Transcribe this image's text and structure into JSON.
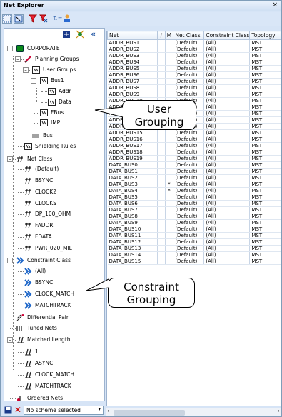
{
  "window": {
    "title": "Net Explorer",
    "close_glyph": "×"
  },
  "tree": [
    {
      "label": "CORPORATE",
      "icon": "corporate-icon"
    },
    {
      "label": "Planning Groups",
      "icon": "planning-icon"
    },
    {
      "label": "User Groups",
      "icon": "bus-icon"
    },
    {
      "label": "Bus1",
      "icon": "bus-icon"
    },
    {
      "label": "Addr",
      "icon": "bus-icon"
    },
    {
      "label": "Data",
      "icon": "bus-icon"
    },
    {
      "label": "FBus",
      "icon": "bus-icon"
    },
    {
      "label": "IMP",
      "icon": "bus-icon"
    },
    {
      "label": "Bus",
      "icon": "bus-lines-icon"
    },
    {
      "label": "Shielding Rules",
      "icon": "bus-icon"
    },
    {
      "label": "Net Class",
      "icon": "net-icon"
    },
    {
      "label": "(Default)",
      "icon": "net-icon"
    },
    {
      "label": "BSYNC",
      "icon": "net-icon"
    },
    {
      "label": "CLOCK2",
      "icon": "net-icon"
    },
    {
      "label": "CLOCKS",
      "icon": "net-icon"
    },
    {
      "label": "DP_100_OHM",
      "icon": "net-icon"
    },
    {
      "label": "FADDR",
      "icon": "net-icon"
    },
    {
      "label": "FDATA",
      "icon": "net-icon"
    },
    {
      "label": "PWR_020_MIL",
      "icon": "net-icon"
    },
    {
      "label": "Constraint Class",
      "icon": "constraint-class-icon"
    },
    {
      "label": "(All)",
      "icon": "constraint-class-icon"
    },
    {
      "label": "BSYNC",
      "icon": "constraint-class-icon"
    },
    {
      "label": "CLOCK_MATCH",
      "icon": "constraint-class-icon"
    },
    {
      "label": "MATCHTRACK",
      "icon": "constraint-class-icon"
    },
    {
      "label": "Differential Pair",
      "icon": "diff-pair-icon"
    },
    {
      "label": "Tuned Nets",
      "icon": "tuned-nets-icon"
    },
    {
      "label": "Matched Length",
      "icon": "matched-length-icon"
    },
    {
      "label": "1",
      "icon": "matched-length-icon"
    },
    {
      "label": "ASYNC",
      "icon": "matched-length-icon"
    },
    {
      "label": "CLOCK_MATCH",
      "icon": "matched-length-icon"
    },
    {
      "label": "MATCHTRACK",
      "icon": "matched-length-icon"
    },
    {
      "label": "Ordered Nets",
      "icon": "ordered-nets-icon"
    }
  ],
  "grid": {
    "headers": [
      "Net",
      "/",
      "M",
      "Net Class",
      "Constraint Class",
      "Topology"
    ],
    "rows": [
      [
        "ADDR_BUS1",
        "",
        "",
        "(Default)",
        "(All)",
        "MST"
      ],
      [
        "ADDR_BUS2",
        "",
        "",
        "(Default)",
        "(All)",
        "MST"
      ],
      [
        "ADDR_BUS3",
        "",
        "",
        "(Default)",
        "(All)",
        "MST"
      ],
      [
        "ADDR_BUS4",
        "",
        "",
        "(Default)",
        "(All)",
        "MST"
      ],
      [
        "ADDR_BUS5",
        "",
        "",
        "(Default)",
        "(All)",
        "MST"
      ],
      [
        "ADDR_BUS6",
        "",
        "",
        "(Default)",
        "(All)",
        "MST"
      ],
      [
        "ADDR_BUS7",
        "",
        "",
        "(Default)",
        "(All)",
        "MST"
      ],
      [
        "ADDR_BUS8",
        "",
        "",
        "(Default)",
        "(All)",
        "MST"
      ],
      [
        "ADDR_BUS9",
        "",
        "",
        "(Default)",
        "(All)",
        "MST"
      ],
      [
        "ADDR_BUS10",
        "",
        "",
        "(Default)",
        "(All)",
        "MST"
      ],
      [
        "ADDR_BUS11",
        "",
        "",
        "(Default)",
        "(All)",
        "MST"
      ],
      [
        "ADDR_BUS12",
        "",
        "",
        "(Default)",
        "(All)",
        "MST"
      ],
      [
        "ADDR_BUS13",
        "",
        "",
        "(Default)",
        "(All)",
        "MST"
      ],
      [
        "ADDR_BUS14",
        "",
        "",
        "(Default)",
        "(All)",
        "MST"
      ],
      [
        "ADDR_BUS15",
        "",
        "",
        "(Default)",
        "(All)",
        "MST"
      ],
      [
        "ADDR_BUS16",
        "",
        "",
        "(Default)",
        "(All)",
        "MST"
      ],
      [
        "ADDR_BUS17",
        "",
        "",
        "(Default)",
        "(All)",
        "MST"
      ],
      [
        "ADDR_BUS18",
        "",
        "",
        "(Default)",
        "(All)",
        "MST"
      ],
      [
        "ADDR_BUS19",
        "",
        "",
        "(Default)",
        "(All)",
        "MST"
      ],
      [
        "DATA_BUS0",
        "",
        "",
        "(Default)",
        "(All)",
        "MST"
      ],
      [
        "DATA_BUS1",
        "",
        "",
        "(Default)",
        "(All)",
        "MST"
      ],
      [
        "DATA_BUS2",
        "",
        "",
        "(Default)",
        "(All)",
        "MST"
      ],
      [
        "DATA_BUS3",
        "",
        "*",
        "(Default)",
        "(All)",
        "MST"
      ],
      [
        "DATA_BUS4",
        "",
        "*",
        "(Default)",
        "(All)",
        "MST"
      ],
      [
        "DATA_BUS5",
        "",
        "",
        "(Default)",
        "(All)",
        "MST"
      ],
      [
        "DATA_BUS6",
        "",
        "",
        "(Default)",
        "(All)",
        "MST"
      ],
      [
        "DATA_BUS7",
        "",
        "",
        "(Default)",
        "(All)",
        "MST"
      ],
      [
        "DATA_BUS8",
        "",
        "",
        "(Default)",
        "(All)",
        "MST"
      ],
      [
        "DATA_BUS9",
        "",
        "",
        "(Default)",
        "(All)",
        "MST"
      ],
      [
        "DATA_BUS10",
        "",
        "",
        "(Default)",
        "(All)",
        "MST"
      ],
      [
        "DATA_BUS11",
        "",
        "",
        "(Default)",
        "(All)",
        "MST"
      ],
      [
        "DATA_BUS12",
        "",
        "",
        "(Default)",
        "(All)",
        "MST"
      ],
      [
        "DATA_BUS13",
        "",
        "",
        "(Default)",
        "(All)",
        "MST"
      ],
      [
        "DATA_BUS14",
        "",
        "",
        "(Default)",
        "(All)",
        "MST"
      ],
      [
        "DATA_BUS15",
        "",
        "",
        "(Default)",
        "(All)",
        "MST"
      ]
    ]
  },
  "callouts": {
    "user_grouping": "User\nGrouping",
    "constraint_grouping": "Constraint\nGrouping"
  },
  "scheme": {
    "value": "No scheme selected"
  }
}
